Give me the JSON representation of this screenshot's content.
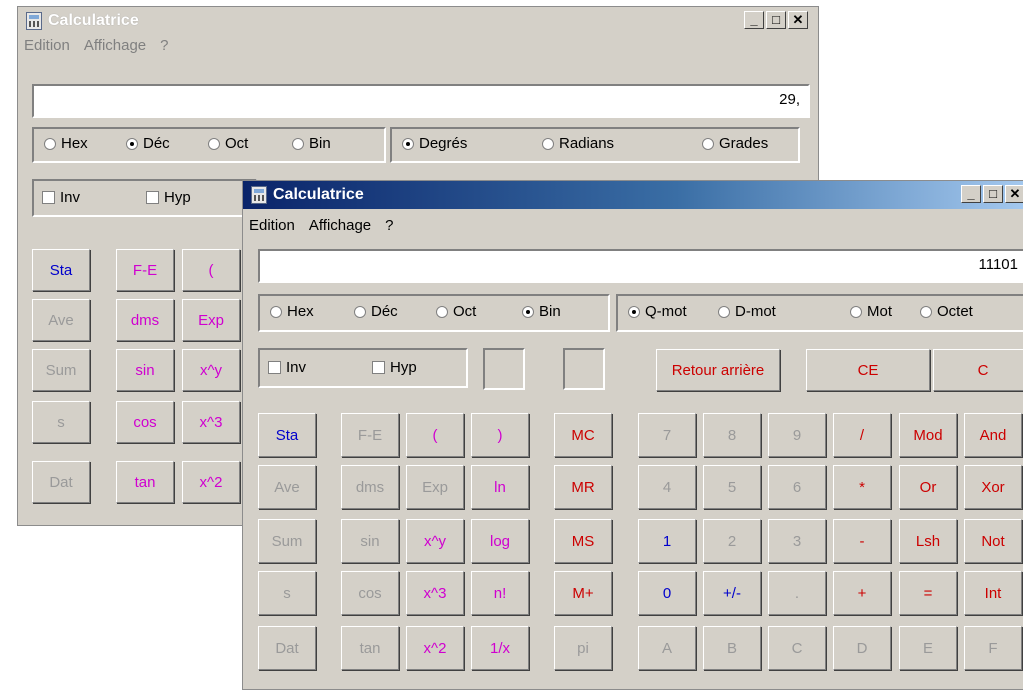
{
  "back": {
    "title": "Calculatrice",
    "menu": [
      "Edition",
      "Affichage",
      "?"
    ],
    "display_value": "29,",
    "bases": [
      {
        "label": "Hex",
        "selected": false
      },
      {
        "label": "Déc",
        "selected": true
      },
      {
        "label": "Oct",
        "selected": false
      },
      {
        "label": "Bin",
        "selected": false
      }
    ],
    "angles": [
      {
        "label": "Degrés",
        "selected": true
      },
      {
        "label": "Radians",
        "selected": false
      },
      {
        "label": "Grades",
        "selected": false
      }
    ],
    "inv_label": "Inv",
    "hyp_label": "Hyp",
    "stat_buttons": [
      "Sta",
      "Ave",
      "Sum",
      "s",
      "Dat"
    ],
    "fn_col1": [
      "F-E",
      "dms",
      "sin",
      "cos",
      "tan"
    ],
    "fn_col2": [
      "(",
      "Exp",
      "x^y",
      "x^3",
      "x^2"
    ]
  },
  "front": {
    "title": "Calculatrice",
    "menu": [
      "Edition",
      "Affichage",
      "?"
    ],
    "display_value": "11101",
    "bases": [
      {
        "label": "Hex",
        "selected": false
      },
      {
        "label": "Déc",
        "selected": false
      },
      {
        "label": "Oct",
        "selected": false
      },
      {
        "label": "Bin",
        "selected": true
      }
    ],
    "word_sizes": [
      {
        "label": "Q-mot",
        "selected": true
      },
      {
        "label": "D-mot",
        "selected": false
      },
      {
        "label": "Mot",
        "selected": false
      },
      {
        "label": "Octet",
        "selected": false
      }
    ],
    "inv_label": "Inv",
    "hyp_label": "Hyp",
    "backspace_label": "Retour arrière",
    "ce_label": "CE",
    "c_label": "C",
    "grid": [
      [
        "Sta",
        "F-E",
        "(",
        ")",
        "MC",
        "7",
        "8",
        "9",
        "/",
        "Mod",
        "And"
      ],
      [
        "Ave",
        "dms",
        "Exp",
        "ln",
        "MR",
        "4",
        "5",
        "6",
        "*",
        "Or",
        "Xor"
      ],
      [
        "Sum",
        "sin",
        "x^y",
        "log",
        "MS",
        "1",
        "2",
        "3",
        "-",
        "Lsh",
        "Not"
      ],
      [
        "s",
        "cos",
        "x^3",
        "n!",
        "M+",
        "0",
        "+/-",
        ".",
        "+",
        "=",
        "Int"
      ],
      [
        "Dat",
        "tan",
        "x^2",
        "1/x",
        "pi",
        "A",
        "B",
        "C",
        "D",
        "E",
        "F"
      ]
    ],
    "grid_colors": [
      [
        "blue",
        "gray",
        "mag",
        "mag",
        "red",
        "gray",
        "gray",
        "gray",
        "red",
        "red",
        "red"
      ],
      [
        "gray",
        "gray",
        "gray",
        "mag",
        "red",
        "gray",
        "gray",
        "gray",
        "red",
        "red",
        "red"
      ],
      [
        "gray",
        "gray",
        "mag",
        "mag",
        "red",
        "blue",
        "gray",
        "gray",
        "red",
        "red",
        "red"
      ],
      [
        "gray",
        "gray",
        "mag",
        "mag",
        "red",
        "blue",
        "blue",
        "gray",
        "red",
        "red",
        "red"
      ],
      [
        "gray",
        "gray",
        "mag",
        "mag",
        "gray",
        "gray",
        "gray",
        "gray",
        "gray",
        "gray",
        "gray"
      ]
    ]
  },
  "colors": {
    "face": "#d4d0c8",
    "blue": "#0000cc",
    "magenta": "#d000d0",
    "red": "#cc0000",
    "disabled": "#9a9a9a",
    "title_active": "#0a246a"
  }
}
